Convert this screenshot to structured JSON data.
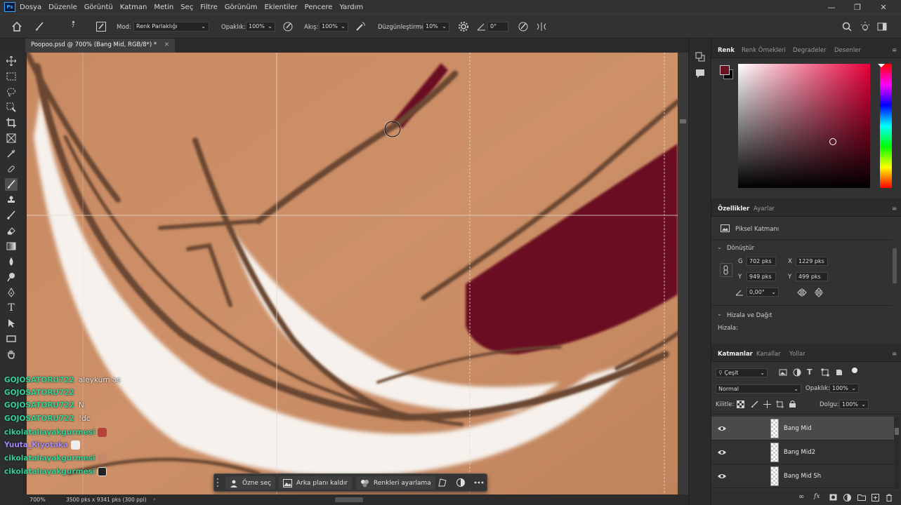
{
  "app": {
    "logo_text": "Ps",
    "menu": [
      "Dosya",
      "Düzenle",
      "Görüntü",
      "Katman",
      "Metin",
      "Seç",
      "Filtre",
      "Görünüm",
      "Eklentiler",
      "Pencere",
      "Yardım"
    ]
  },
  "options_bar": {
    "brush_size": "7",
    "mode_label": "Mod:",
    "mode_value": "Renk Parlaklığı",
    "opacity_label": "Opaklık:",
    "opacity_value": "100%",
    "flow_label": "Akış:",
    "flow_value": "100%",
    "smoothing_label": "Düzgünleştirme:",
    "smoothing_value": "10%",
    "angle_value": "0°"
  },
  "document": {
    "tab_title": "Poopoo.psd @ 700% (Bang Mid, RGB/8*) *",
    "zoom": "700%",
    "doc_info": "3500 pks x 9341 pks (300 ppi)"
  },
  "chat": [
    {
      "user": "GOJOSATORU722",
      "message": "aleyküm as"
    },
    {
      "user": "GOJOSATORU722",
      "message": ""
    },
    {
      "user": "GOJOSATORU722",
      "message": "N"
    },
    {
      "user": "GOJOSATORU722",
      "message": "!dc"
    },
    {
      "user": "cikolatalıayakgurmesi",
      "message": ""
    },
    {
      "user": "Yuuta_Kiyotaka",
      "message": ""
    },
    {
      "user": "cikolatalıayakgurmesi",
      "message": ""
    },
    {
      "user": "cikolatalıayakgurmesi",
      "message": ""
    }
  ],
  "context_bar": {
    "select_subject": "Özne seç",
    "remove_background": "Arka planı kaldır",
    "adjust_colors": "Renkleri ayarlama"
  },
  "color_panel": {
    "tabs": [
      "Renk",
      "Renk Örnekleri",
      "Degradeler",
      "Desenler"
    ],
    "foreground_color": "#6b0f22",
    "background_color": "#000000",
    "hue_color": "#e8003a"
  },
  "properties_panel": {
    "tabs": [
      "Özellikler",
      "Ayarlar"
    ],
    "layer_type": "Piksel Katmanı",
    "transform_header": "Dönüştür",
    "w_label": "G",
    "w_value": "702 pks",
    "x_label": "X",
    "x_value": "1229 pks",
    "h_label": "Y",
    "h_value": "949 pks",
    "y_label": "Y",
    "y_value": "499 pks",
    "angle_value": "0,00°",
    "align_header": "Hizala ve Dağıt",
    "align_label": "Hizala:"
  },
  "layers_panel": {
    "tabs": [
      "Katmanlar",
      "Kanallar",
      "Yollar"
    ],
    "filter_label": "Çeşit",
    "blend_mode": "Normal",
    "opacity_label": "Opaklık:",
    "opacity_value": "100%",
    "lock_label": "Kilitle:",
    "fill_label": "Dolgu:",
    "fill_value": "100%",
    "layers": [
      {
        "name": "Bang Mid",
        "selected": true
      },
      {
        "name": "Bang Mid2",
        "selected": false
      },
      {
        "name": "Bang Mid Sh",
        "selected": false
      }
    ]
  },
  "colors": {
    "skin": "#c98e64",
    "hair": "#6b0f22",
    "line": "#6a4732",
    "highlight": "#f7f3ef",
    "chat_green": "#34d399",
    "chat_purple": "#a78bfa"
  }
}
